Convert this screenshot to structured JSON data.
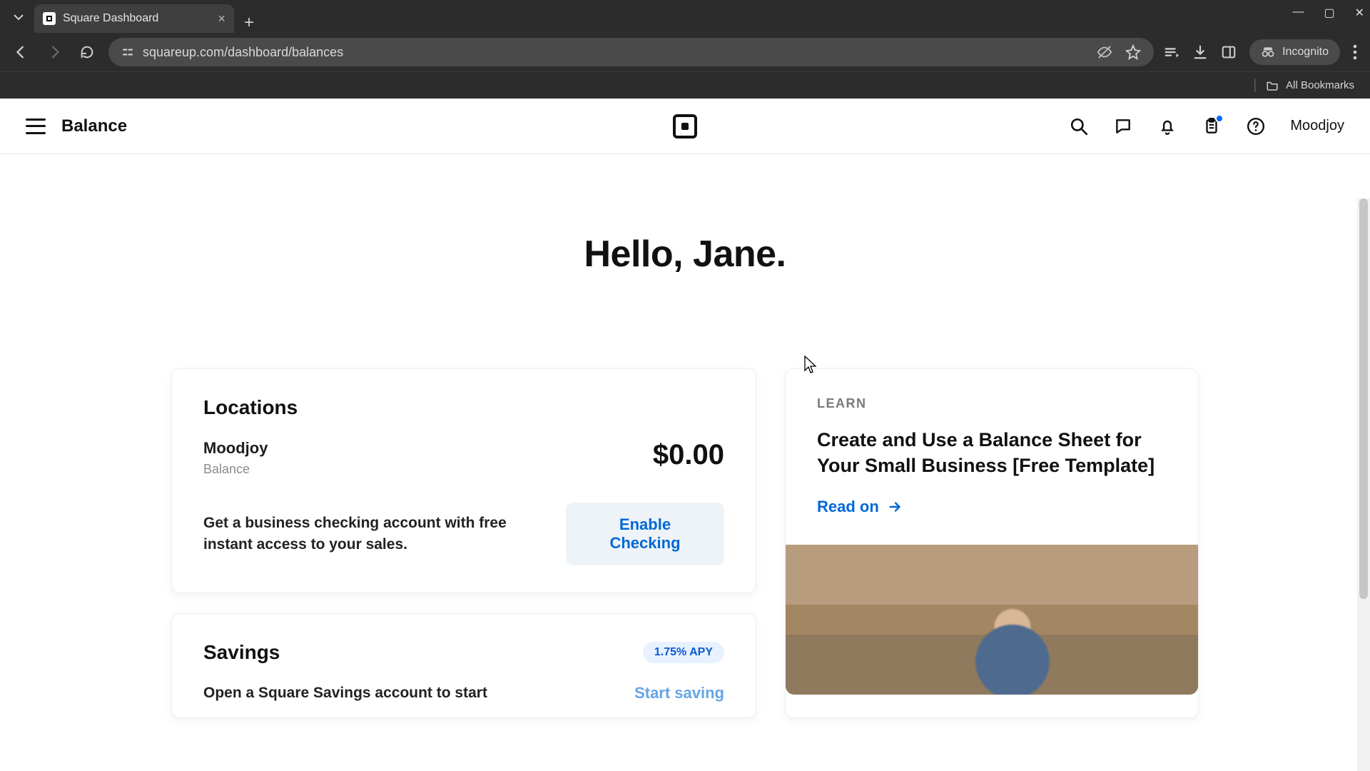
{
  "browser": {
    "tab_title": "Square Dashboard",
    "url": "squareup.com/dashboard/balances",
    "incognito_label": "Incognito",
    "bookmarks_label": "All Bookmarks"
  },
  "header": {
    "title": "Balance",
    "account_name": "Moodjoy"
  },
  "greeting": "Hello, Jane.",
  "locations_card": {
    "title": "Locations",
    "location_name": "Moodjoy",
    "location_sublabel": "Balance",
    "location_amount": "$0.00",
    "cta_text": "Get a business checking account with free instant access to your sales.",
    "cta_button": "Enable Checking"
  },
  "savings_card": {
    "title": "Savings",
    "apy_badge": "1.75% APY",
    "body_text": "Open a Square Savings account to start",
    "cta_link": "Start saving"
  },
  "learn_card": {
    "eyebrow": "LEARN",
    "title": "Create and Use a Balance Sheet for Your Small Business [Free Template]",
    "read_on": "Read on"
  }
}
